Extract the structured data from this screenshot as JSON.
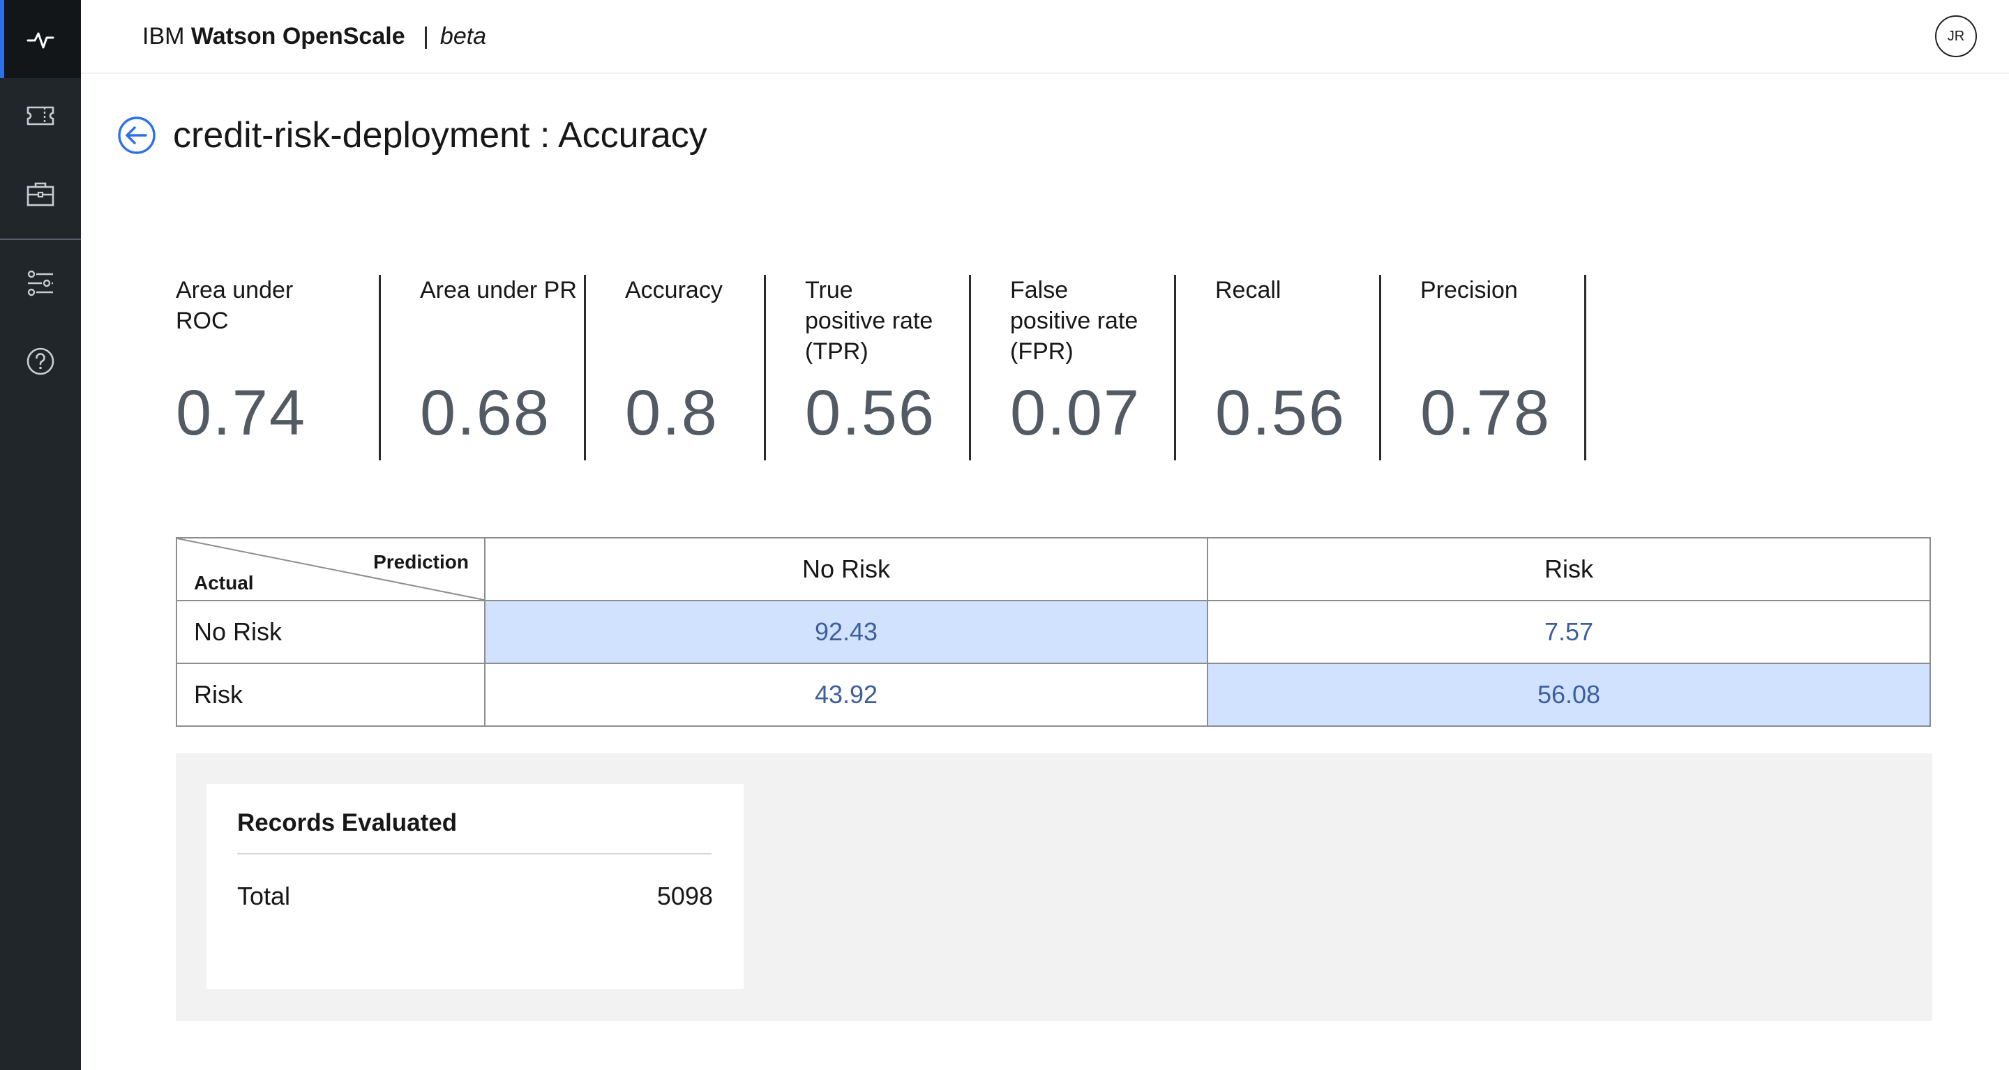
{
  "header": {
    "brand_prefix": "IBM",
    "brand_name": "Watson OpenScale",
    "brand_separator": "|",
    "brand_tag": "beta",
    "avatar_initials": "JR"
  },
  "sidebar": {
    "items": [
      {
        "icon": "activity-pulse-icon",
        "active": true
      },
      {
        "icon": "ticket-icon",
        "active": false
      },
      {
        "icon": "briefcase-icon",
        "active": false
      },
      {
        "icon": "sliders-icon",
        "active": false
      },
      {
        "icon": "help-icon",
        "active": false
      }
    ]
  },
  "page": {
    "title": "credit-risk-deployment : Accuracy"
  },
  "metrics": [
    {
      "label": "Area under ROC",
      "value": "0.74"
    },
    {
      "label": "Area under PR",
      "value": "0.68"
    },
    {
      "label": "Accuracy",
      "value": "0.8"
    },
    {
      "label": "True positive rate (TPR)",
      "value": "0.56"
    },
    {
      "label": "False positive rate (FPR)",
      "value": "0.07"
    },
    {
      "label": "Recall",
      "value": "0.56"
    },
    {
      "label": "Precision",
      "value": "0.78"
    }
  ],
  "matrix": {
    "prediction_label": "Prediction",
    "actual_label": "Actual",
    "columns": [
      "No Risk",
      "Risk"
    ],
    "rows": [
      {
        "label": "No Risk",
        "values": [
          "92.43",
          "7.57"
        ]
      },
      {
        "label": "Risk",
        "values": [
          "43.92",
          "56.08"
        ]
      }
    ],
    "highlight_color": "#d0e2ff"
  },
  "records": {
    "title": "Records Evaluated",
    "total_label": "Total",
    "total_value": "5098"
  },
  "colors": {
    "sidebar_bg": "#21262b",
    "accent": "#2f6fe8",
    "metric_value": "#525a63",
    "matrix_value": "#3d5f9e"
  }
}
